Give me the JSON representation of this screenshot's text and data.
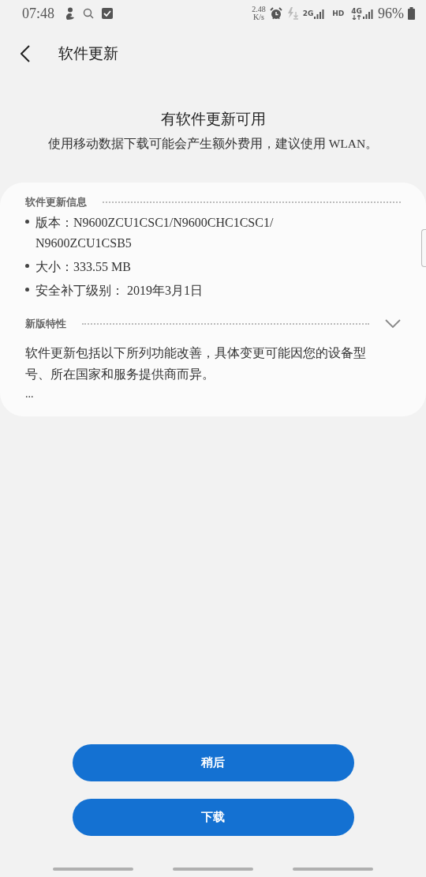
{
  "status_bar": {
    "time": "07:48",
    "speed_value": "2.48",
    "speed_unit": "K/s",
    "network_2g": "2G",
    "hd": "HD",
    "network_4g": "4G",
    "battery": "96%"
  },
  "header": {
    "title": "软件更新"
  },
  "notice": {
    "title": "有软件更新可用",
    "message": "使用移动数据下载可能会产生额外费用，建议使用 WLAN。"
  },
  "info_section": {
    "heading": "软件更新信息",
    "items": [
      {
        "label": "版本：",
        "value": "N9600ZCU1CSC1/N9600CHC1CSC1/\nN9600ZCU1CSB5"
      },
      {
        "label": "大小：",
        "value": "333.55 MB"
      },
      {
        "label": "安全补丁级别：",
        "value": " 2019年3月1日"
      }
    ]
  },
  "features_section": {
    "heading": "新版特性",
    "expanded": false,
    "text": "软件更新包括以下所列功能改善，具体变更可能因您的设备型号、所在国家和服务提供商而异。",
    "more": "..."
  },
  "buttons": [
    {
      "label": "稍后"
    },
    {
      "label": "下载"
    }
  ]
}
